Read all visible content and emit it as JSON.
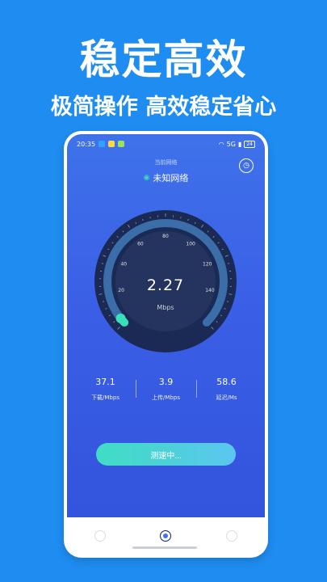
{
  "promo": {
    "title": "稳定高效",
    "subtitle": "极简操作 高效稳定省心"
  },
  "statusbar": {
    "time": "20:35",
    "signal": "5G",
    "battery": "24"
  },
  "network": {
    "label": "当前网络",
    "name": "未知网络"
  },
  "gauge": {
    "value": "2.27",
    "unit": "Mbps",
    "ticks": [
      "20",
      "40",
      "60",
      "80",
      "100",
      "120",
      "140"
    ],
    "level": 0.02
  },
  "stats": [
    {
      "value": "37.1",
      "label": "下载/Mbps"
    },
    {
      "value": "3.9",
      "label": "上传/Mbps"
    },
    {
      "value": "58.6",
      "label": "延迟/Ms"
    }
  ],
  "test_button": {
    "label": "测速中..."
  },
  "colors": {
    "accent": "#37e0b8",
    "background": "#1e8cf0"
  }
}
